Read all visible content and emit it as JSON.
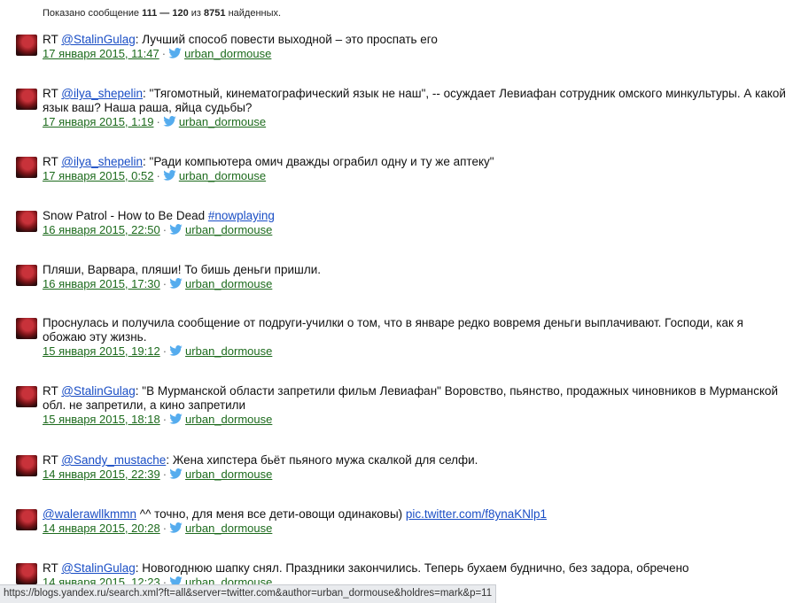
{
  "summary": {
    "prefix": "Показано сообщение",
    "from": "111",
    "dash": "—",
    "to": "120",
    "of": "из",
    "total": "8751",
    "suffix": "найденных."
  },
  "author": "urban_dormouse",
  "posts": [
    {
      "rt": "RT",
      "mention": "@StalinGulag",
      "text": ": Лучший способ повести выходной – это проспать его",
      "date": "17 января 2015, 11:47"
    },
    {
      "rt": "RT",
      "mention": "@ilya_shepelin",
      "text": ": \"Тягомотный, кинематографический язык не наш\", -- осуждает Левиафан сотрудник омского минкультуры. А какой язык ваш? Наша раша, яйца судьбы?",
      "date": "17 января 2015, 1:19"
    },
    {
      "rt": "RT",
      "mention": "@ilya_shepelin",
      "text": ": \"Ради компьютера омич дважды ограбил одну и ту же аптеку\"",
      "date": "17 января 2015, 0:52"
    },
    {
      "text": "Snow Patrol - How to Be Dead ",
      "tag": "#nowplaying",
      "date": "16 января 2015, 22:50"
    },
    {
      "text": "Пляши, Варвара, пляши! То бишь деньги пришли.",
      "date": "16 января 2015, 17:30"
    },
    {
      "text": "Проснулась и получила сообщение от подруги-училки о том, что в январе редко вовремя деньги выплачивают. Господи, как я обожаю эту жизнь.",
      "date": "15 января 2015, 19:12"
    },
    {
      "rt": "RT",
      "mention": "@StalinGulag",
      "text": ": \"В Мурманской области запретили фильм Левиафан\" Воровство, пьянство, продажных чиновников в Мурманской обл. не запретили, а кино запретили",
      "date": "15 января 2015, 18:18"
    },
    {
      "rt": "RT",
      "mention": "@Sandy_mustache",
      "text": ": Жена хипстера бьёт пьяного мужа скалкой для селфи.",
      "date": "14 января 2015, 22:39"
    },
    {
      "mention": "@walerawllkmmn",
      "text": " ^^ точно, для меня все дети-овощи одинаковы) ",
      "pic": "pic.twitter.com/f8ynaKNlp1",
      "date": "14 января 2015, 20:28"
    },
    {
      "rt": "RT",
      "mention": "@StalinGulag",
      "text": ": Новогоднюю шапку снял. Праздники закончились. Теперь бухаем буднично, без задора, обречено",
      "date": "14 января 2015, 12:23"
    }
  ],
  "status_url": "https://blogs.yandex.ru/search.xml?ft=all&server=twitter.com&author=urban_dormouse&holdres=mark&p=11",
  "colors": {
    "link": "#1a4ec5",
    "date": "#1d6b1d",
    "twitter": "#55acee"
  }
}
